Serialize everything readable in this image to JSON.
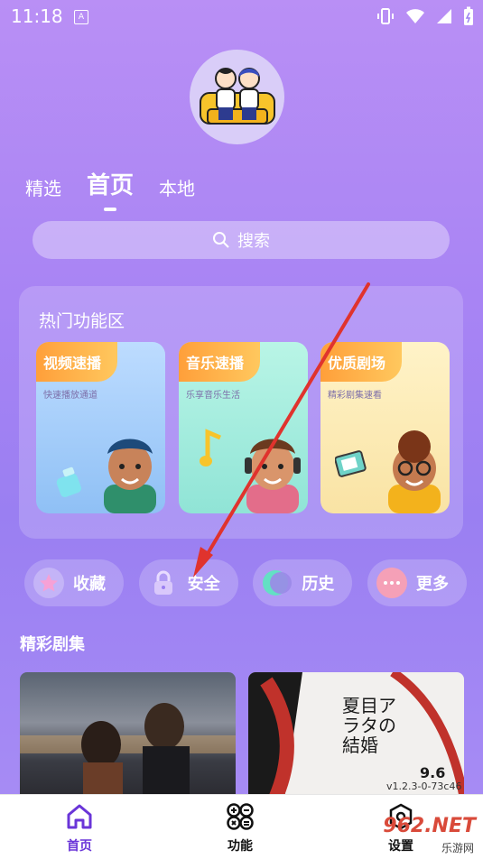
{
  "status": {
    "time": "11:18",
    "a_label": "A"
  },
  "tabs": [
    {
      "label": "精选",
      "active": false
    },
    {
      "label": "首页",
      "active": true
    },
    {
      "label": "本地",
      "active": false
    }
  ],
  "search": {
    "label": "搜索"
  },
  "hot": {
    "title": "热门功能区",
    "cards": [
      {
        "title": "视频速播",
        "subtitle": "快速播放通道",
        "color": "#a9d0fb"
      },
      {
        "title": "音乐速播",
        "subtitle": "乐享音乐生活",
        "color": "#a8ecd9"
      },
      {
        "title": "优质剧场",
        "subtitle": "精彩剧集速看",
        "color": "#fbeec0"
      }
    ]
  },
  "chips": [
    {
      "label": "收藏",
      "icon": "star-icon"
    },
    {
      "label": "安全",
      "icon": "lock-icon"
    },
    {
      "label": "历史",
      "icon": "toggle-icon"
    },
    {
      "label": "更多",
      "icon": "more-icon"
    }
  ],
  "section": {
    "title": "精彩剧集"
  },
  "posters": [
    {
      "name": "poster-romance"
    },
    {
      "name": "poster-japanese-drama",
      "text": "夏目アラタの結婚",
      "date": "9.6"
    }
  ],
  "version": "v1.2.3-0-73c46",
  "nav": [
    {
      "label": "首页",
      "active": true
    },
    {
      "label": "功能",
      "active": false
    },
    {
      "label": "设置",
      "active": false
    }
  ],
  "watermark": {
    "brand": "962.NET",
    "sub": "乐游网"
  },
  "colors": {
    "accent": "#6a35d8",
    "tag": "#ff9f3a"
  }
}
